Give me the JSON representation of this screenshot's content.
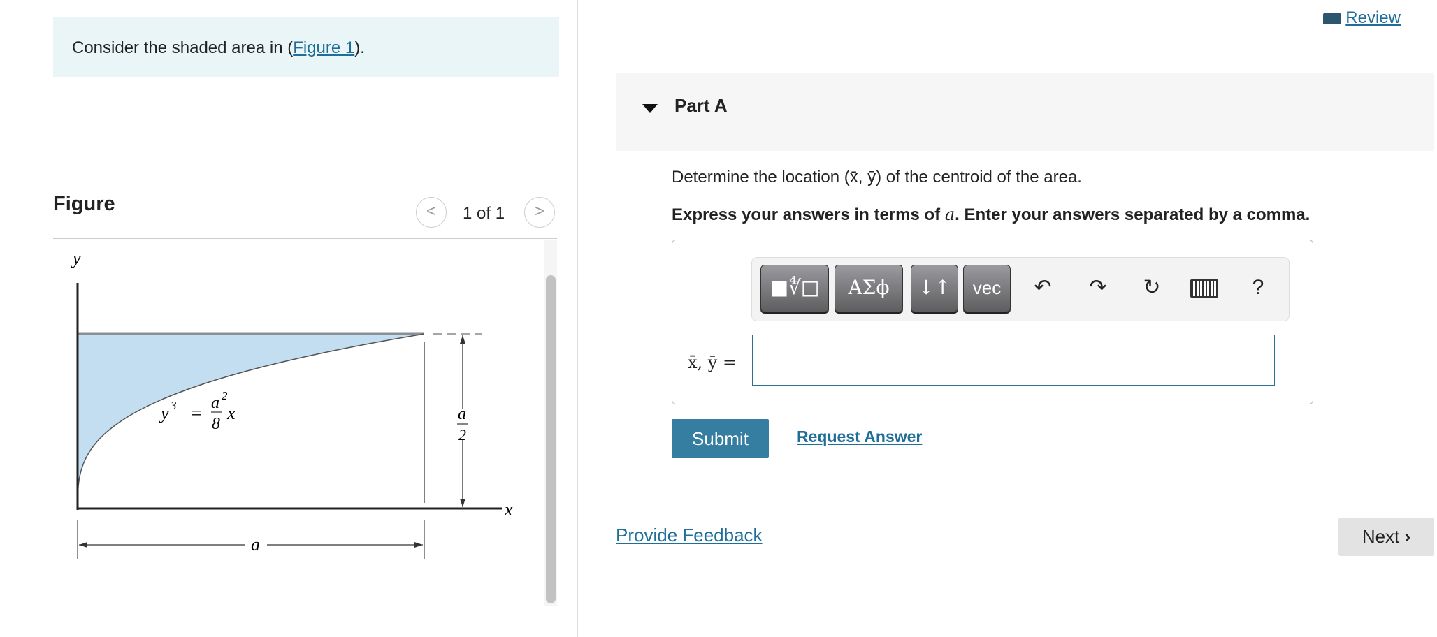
{
  "intro": {
    "prefix": "Consider the shaded area in (",
    "link": "Figure 1",
    "suffix": ")."
  },
  "figure": {
    "title": "Figure",
    "pager": "1 of 1",
    "prev_icon": "chevron-left-icon",
    "next_icon": "chevron-right-icon",
    "labels": {
      "y_axis": "y",
      "x_axis": "x",
      "equation_lhs": "y",
      "equation_exp": "3",
      "equation_eq": "=",
      "equation_num": "a",
      "equation_num_exp": "2",
      "equation_den": "8",
      "equation_var": "x",
      "height_num": "a",
      "height_den": "2",
      "width": "a"
    },
    "fill_color": "#c2def0"
  },
  "review": {
    "icon": "book-icon",
    "label": "Review"
  },
  "part": {
    "label": "Part A",
    "question": "Determine the location (x̄, ȳ) of the centroid of the area.",
    "instruction_pre": "Express your answers in terms of ",
    "instruction_var": "a",
    "instruction_post": ". Enter your answers separated by a comma."
  },
  "toolbar": {
    "templates": "■∜□",
    "greek": "AΣϕ",
    "arrows": "↓↑",
    "vec": "vec",
    "undo": "undo-icon",
    "redo": "redo-icon",
    "reset": "reset-icon",
    "keyboard": "keyboard-icon",
    "help": "?"
  },
  "answer": {
    "label": "x̄, ȳ =",
    "value": ""
  },
  "actions": {
    "submit": "Submit",
    "request": "Request Answer",
    "feedback": "Provide Feedback",
    "next": "Next"
  },
  "colors": {
    "link": "#1f6e9a",
    "submit": "#357ea2"
  }
}
